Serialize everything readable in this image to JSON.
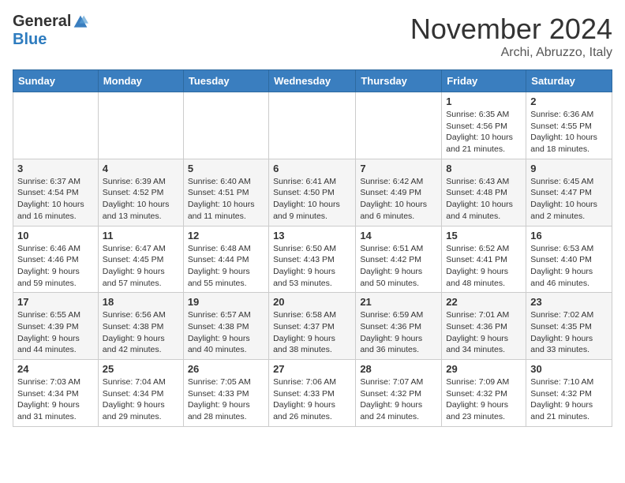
{
  "header": {
    "logo_general": "General",
    "logo_blue": "Blue",
    "month_title": "November 2024",
    "location": "Archi, Abruzzo, Italy"
  },
  "weekdays": [
    "Sunday",
    "Monday",
    "Tuesday",
    "Wednesday",
    "Thursday",
    "Friday",
    "Saturday"
  ],
  "weeks": [
    [
      {
        "day": "",
        "info": ""
      },
      {
        "day": "",
        "info": ""
      },
      {
        "day": "",
        "info": ""
      },
      {
        "day": "",
        "info": ""
      },
      {
        "day": "",
        "info": ""
      },
      {
        "day": "1",
        "info": "Sunrise: 6:35 AM\nSunset: 4:56 PM\nDaylight: 10 hours\nand 21 minutes."
      },
      {
        "day": "2",
        "info": "Sunrise: 6:36 AM\nSunset: 4:55 PM\nDaylight: 10 hours\nand 18 minutes."
      }
    ],
    [
      {
        "day": "3",
        "info": "Sunrise: 6:37 AM\nSunset: 4:54 PM\nDaylight: 10 hours\nand 16 minutes."
      },
      {
        "day": "4",
        "info": "Sunrise: 6:39 AM\nSunset: 4:52 PM\nDaylight: 10 hours\nand 13 minutes."
      },
      {
        "day": "5",
        "info": "Sunrise: 6:40 AM\nSunset: 4:51 PM\nDaylight: 10 hours\nand 11 minutes."
      },
      {
        "day": "6",
        "info": "Sunrise: 6:41 AM\nSunset: 4:50 PM\nDaylight: 10 hours\nand 9 minutes."
      },
      {
        "day": "7",
        "info": "Sunrise: 6:42 AM\nSunset: 4:49 PM\nDaylight: 10 hours\nand 6 minutes."
      },
      {
        "day": "8",
        "info": "Sunrise: 6:43 AM\nSunset: 4:48 PM\nDaylight: 10 hours\nand 4 minutes."
      },
      {
        "day": "9",
        "info": "Sunrise: 6:45 AM\nSunset: 4:47 PM\nDaylight: 10 hours\nand 2 minutes."
      }
    ],
    [
      {
        "day": "10",
        "info": "Sunrise: 6:46 AM\nSunset: 4:46 PM\nDaylight: 9 hours\nand 59 minutes."
      },
      {
        "day": "11",
        "info": "Sunrise: 6:47 AM\nSunset: 4:45 PM\nDaylight: 9 hours\nand 57 minutes."
      },
      {
        "day": "12",
        "info": "Sunrise: 6:48 AM\nSunset: 4:44 PM\nDaylight: 9 hours\nand 55 minutes."
      },
      {
        "day": "13",
        "info": "Sunrise: 6:50 AM\nSunset: 4:43 PM\nDaylight: 9 hours\nand 53 minutes."
      },
      {
        "day": "14",
        "info": "Sunrise: 6:51 AM\nSunset: 4:42 PM\nDaylight: 9 hours\nand 50 minutes."
      },
      {
        "day": "15",
        "info": "Sunrise: 6:52 AM\nSunset: 4:41 PM\nDaylight: 9 hours\nand 48 minutes."
      },
      {
        "day": "16",
        "info": "Sunrise: 6:53 AM\nSunset: 4:40 PM\nDaylight: 9 hours\nand 46 minutes."
      }
    ],
    [
      {
        "day": "17",
        "info": "Sunrise: 6:55 AM\nSunset: 4:39 PM\nDaylight: 9 hours\nand 44 minutes."
      },
      {
        "day": "18",
        "info": "Sunrise: 6:56 AM\nSunset: 4:38 PM\nDaylight: 9 hours\nand 42 minutes."
      },
      {
        "day": "19",
        "info": "Sunrise: 6:57 AM\nSunset: 4:38 PM\nDaylight: 9 hours\nand 40 minutes."
      },
      {
        "day": "20",
        "info": "Sunrise: 6:58 AM\nSunset: 4:37 PM\nDaylight: 9 hours\nand 38 minutes."
      },
      {
        "day": "21",
        "info": "Sunrise: 6:59 AM\nSunset: 4:36 PM\nDaylight: 9 hours\nand 36 minutes."
      },
      {
        "day": "22",
        "info": "Sunrise: 7:01 AM\nSunset: 4:36 PM\nDaylight: 9 hours\nand 34 minutes."
      },
      {
        "day": "23",
        "info": "Sunrise: 7:02 AM\nSunset: 4:35 PM\nDaylight: 9 hours\nand 33 minutes."
      }
    ],
    [
      {
        "day": "24",
        "info": "Sunrise: 7:03 AM\nSunset: 4:34 PM\nDaylight: 9 hours\nand 31 minutes."
      },
      {
        "day": "25",
        "info": "Sunrise: 7:04 AM\nSunset: 4:34 PM\nDaylight: 9 hours\nand 29 minutes."
      },
      {
        "day": "26",
        "info": "Sunrise: 7:05 AM\nSunset: 4:33 PM\nDaylight: 9 hours\nand 28 minutes."
      },
      {
        "day": "27",
        "info": "Sunrise: 7:06 AM\nSunset: 4:33 PM\nDaylight: 9 hours\nand 26 minutes."
      },
      {
        "day": "28",
        "info": "Sunrise: 7:07 AM\nSunset: 4:32 PM\nDaylight: 9 hours\nand 24 minutes."
      },
      {
        "day": "29",
        "info": "Sunrise: 7:09 AM\nSunset: 4:32 PM\nDaylight: 9 hours\nand 23 minutes."
      },
      {
        "day": "30",
        "info": "Sunrise: 7:10 AM\nSunset: 4:32 PM\nDaylight: 9 hours\nand 21 minutes."
      }
    ]
  ]
}
